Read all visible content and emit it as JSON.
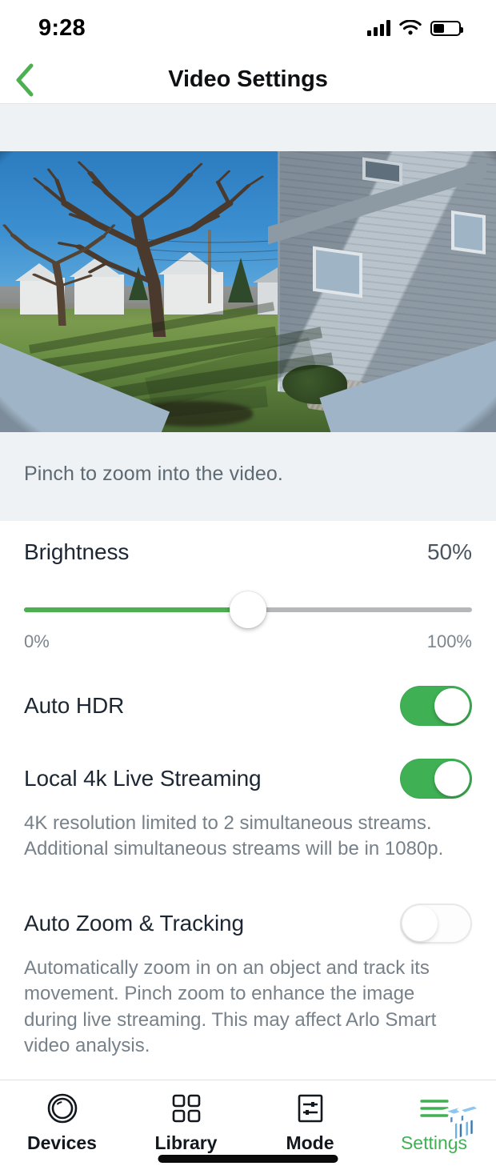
{
  "status_bar": {
    "time": "9:28",
    "signal_icon": "cellular-signal-icon",
    "wifi_icon": "wifi-icon",
    "battery_icon": "battery-icon"
  },
  "nav": {
    "back_icon": "chevron-left-icon",
    "title": "Video Settings",
    "accent_color": "#4caf50"
  },
  "preview": {
    "caption": "Pinch to zoom into the video.",
    "alt": "live camera preview of a residential yard with bare trees, blue sky, white houses and a gray-sided house on the right"
  },
  "settings": {
    "brightness": {
      "label": "Brightness",
      "value": "50%",
      "percent": 50,
      "min_label": "0%",
      "max_label": "100%",
      "fill_color": "#4caf50"
    },
    "auto_hdr": {
      "label": "Auto HDR",
      "state": "on"
    },
    "local_4k": {
      "label": "Local 4k Live Streaming",
      "state": "on",
      "description": "4K resolution limited to 2 simultaneous streams. Additional simultaneous streams will be in 1080p."
    },
    "auto_zoom": {
      "label": "Auto Zoom & Tracking",
      "state": "off",
      "description": "Automatically zoom in on an object and track its movement. Pinch zoom to enhance the image during live streaming. This may affect Arlo Smart video analysis."
    },
    "toggle_on_color": "#3fb054",
    "toggle_off_color": "#fdfdfd"
  },
  "tabbar": {
    "items": [
      {
        "label": "Devices",
        "icon": "camera-lens-icon",
        "active": false
      },
      {
        "label": "Library",
        "icon": "grid-squares-icon",
        "active": false
      },
      {
        "label": "Mode",
        "icon": "sliders-square-icon",
        "active": false
      },
      {
        "label": "Settings",
        "icon": "hamburger-lines-icon",
        "active": true
      }
    ],
    "active_color": "#3fb054"
  },
  "watermark": {
    "name": "tt-logo-watermark"
  }
}
